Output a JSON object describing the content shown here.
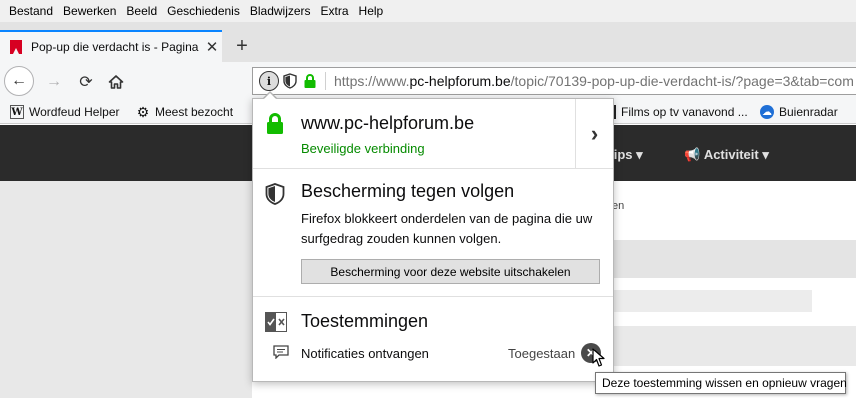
{
  "menubar": {
    "items": [
      "Bestand",
      "Bewerken",
      "Beeld",
      "Geschiedenis",
      "Bladwijzers",
      "Extra",
      "Help"
    ]
  },
  "tab": {
    "title": "Pop-up die verdacht is - Pagina",
    "close_glyph": "✕",
    "new_tab_glyph": "+"
  },
  "navbar": {
    "back_glyph": "←",
    "forward_glyph": "→",
    "reload_glyph": "⟳",
    "info_glyph": "i",
    "url_prefix": "https://www.",
    "url_domain": "pc-helpforum.be",
    "url_path": "/topic/70139-pop-up-die-verdacht-is/?page=3&tab=com"
  },
  "bookmarks": [
    {
      "label": "Wordfeud Helper",
      "icon": "W"
    },
    {
      "label": "Meest bezocht",
      "icon": "gear-icon"
    },
    {
      "label": "Films op tv vanavond ...",
      "icon": "film-icon"
    },
    {
      "label": "Buienradar",
      "icon": "cloud-icon"
    }
  ],
  "page": {
    "nav_tips": "Tips ▾",
    "nav_activiteit": "Activiteit ▾",
    "fragment_en": "en"
  },
  "popup": {
    "host": "www.pc-helpforum.be",
    "status": "Beveiligde verbinding",
    "more_glyph": "›",
    "tp_title": "Bescherming tegen volgen",
    "tp_desc": "Firefox blokkeert onderdelen van de pagina die uw surfgedrag zouden kunnen volgen.",
    "tp_button": "Bescherming voor deze website uitschakelen",
    "perm_title": "Toestemmingen",
    "notif_label": "Notificaties ontvangen",
    "notif_state": "Toegestaan",
    "clear_glyph": "✕",
    "tooltip": "Deze toestemming wissen en opnieuw vragen"
  },
  "colors": {
    "accent": "#0a84ff",
    "secure_green": "#058b00",
    "lock_green": "#12bc00"
  }
}
